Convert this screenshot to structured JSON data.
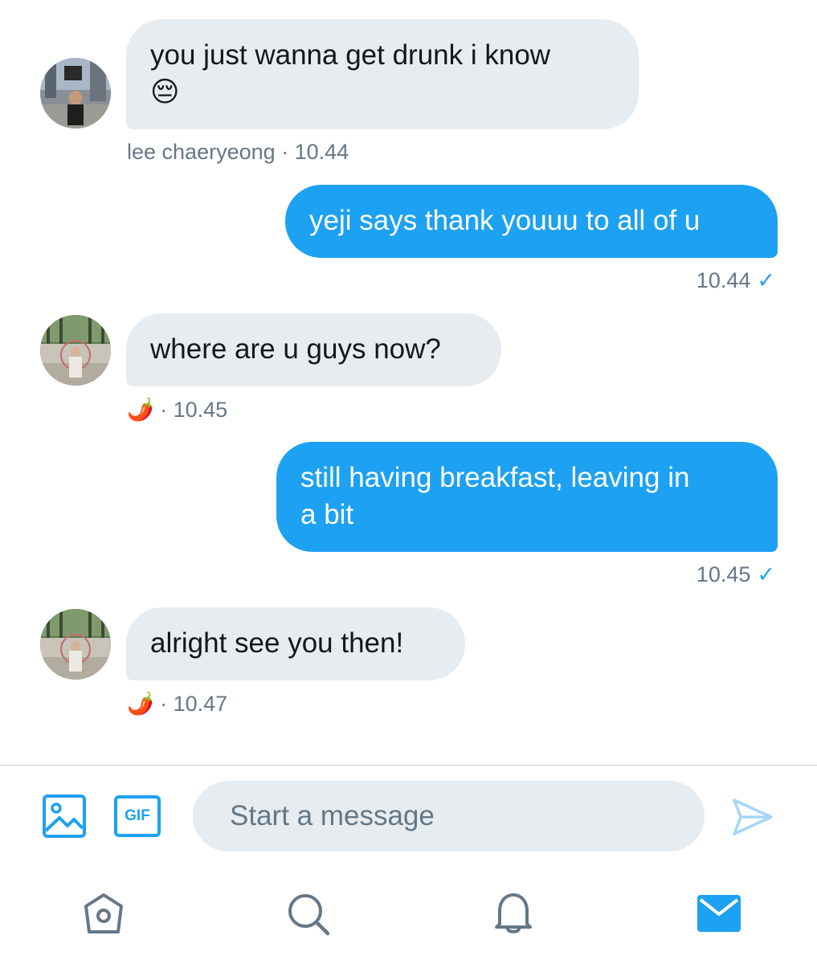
{
  "conversation": {
    "messages": [
      {
        "direction": "incoming",
        "lines": [
          "you just wanna get drunk i know",
          "😔"
        ],
        "sender": "lee chaeryeong",
        "time": "10.44"
      },
      {
        "direction": "outgoing",
        "lines": [
          "yeji says thank youuu to all of u"
        ],
        "time": "10.44",
        "status_icon": "check-icon"
      },
      {
        "direction": "incoming",
        "lines": [
          "where are u guys now?"
        ],
        "sender": "🌶️",
        "time": "10.45"
      },
      {
        "direction": "outgoing",
        "lines": [
          "still having breakfast, leaving in",
          "a bit"
        ],
        "time": "10.45",
        "status_icon": "check-icon"
      },
      {
        "direction": "incoming",
        "lines": [
          "alright see you then!"
        ],
        "sender": "🌶️",
        "time": "10.47"
      }
    ],
    "separator": " · "
  },
  "composer": {
    "placeholder": "Start a message",
    "gif_label": "GIF",
    "icons": [
      "image-icon",
      "gif-icon",
      "send-icon"
    ]
  },
  "bottom_nav": {
    "items": [
      "home-icon",
      "search-icon",
      "notifications-icon",
      "messages-icon"
    ],
    "active": "messages-icon"
  },
  "colors": {
    "accent": "#1da1f2",
    "incoming_bubble": "#e6ecf0",
    "meta_text": "#657786",
    "icon_gray": "#657786"
  }
}
